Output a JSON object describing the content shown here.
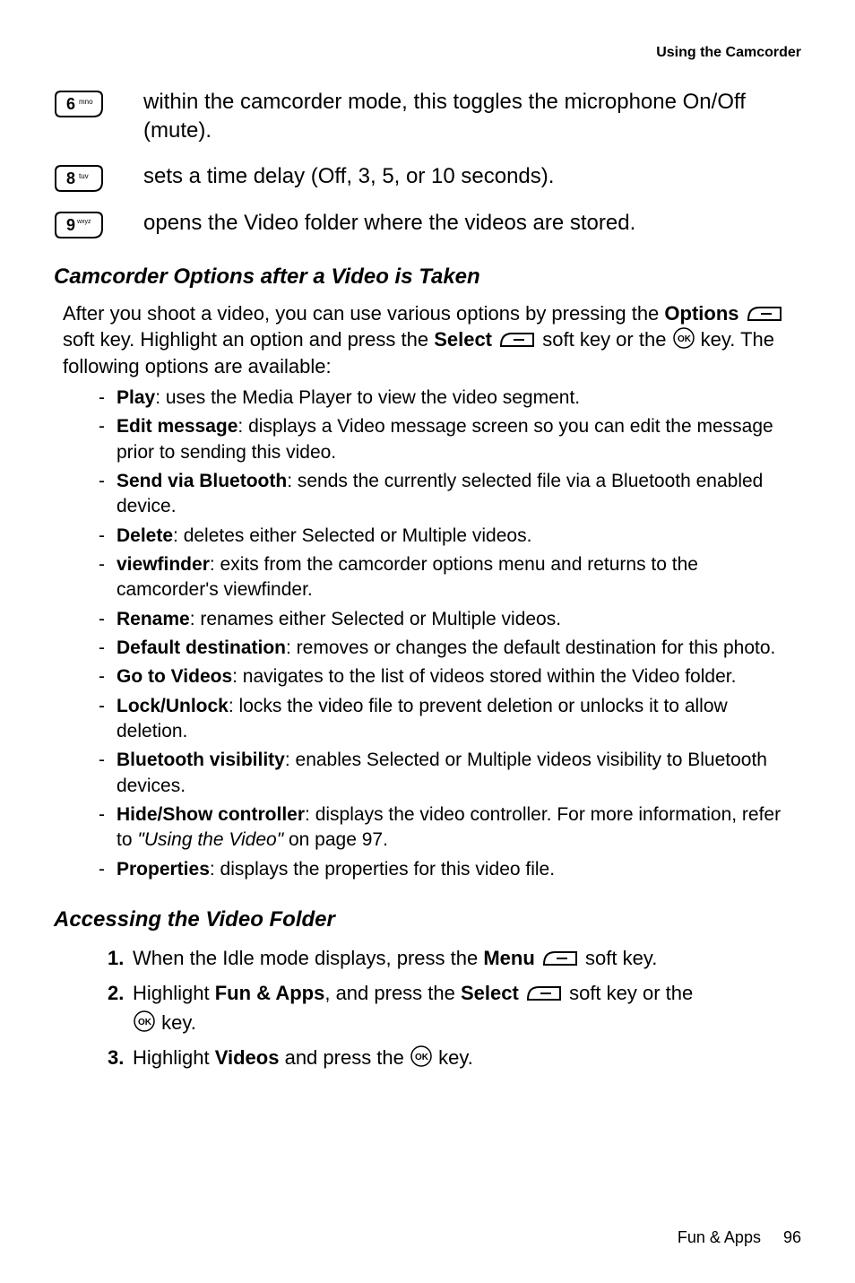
{
  "header": {
    "section": "Using the Camcorder"
  },
  "keys": [
    {
      "label": "6",
      "sub": "mno",
      "desc": "within the camcorder mode, this toggles the microphone On/Off (mute)."
    },
    {
      "label": "8",
      "sub": "tuv",
      "desc": "sets a time delay (Off, 3, 5, or 10 seconds)."
    },
    {
      "label": "9",
      "sub": "wxyz",
      "desc": "opens the Video folder where the videos are stored."
    }
  ],
  "section1": {
    "heading": "Camcorder Options after a Video is Taken",
    "intro_1": "After you shoot a video, you can use various options by pressing the ",
    "intro_options": "Options",
    "intro_2": " soft key. Highlight an option and press the ",
    "intro_select": "Select",
    "intro_3": " soft key or the ",
    "intro_4": " key. The following options are available:",
    "bullets": [
      {
        "term": "Play",
        "rest": ": uses the Media Player to view the video segment."
      },
      {
        "term": "Edit message",
        "rest": ": displays a Video message screen so you can edit the message prior to sending this video."
      },
      {
        "term": "Send via Bluetooth",
        "rest": ": sends the currently selected file via a Bluetooth enabled device."
      },
      {
        "term": "Delete",
        "rest": ": deletes either Selected or Multiple videos."
      },
      {
        "term": "viewfinder",
        "rest": ": exits from the camcorder options menu and returns to the camcorder's viewfinder."
      },
      {
        "term": "Rename",
        "rest": ": renames either Selected or Multiple videos."
      },
      {
        "term": "Default destination",
        "rest": ": removes or changes the default destination for this photo."
      },
      {
        "term": "Go to Videos",
        "rest": ": navigates to the list of videos stored within the Video folder."
      },
      {
        "term": "Lock/Unlock",
        "rest": ": locks the video file to prevent deletion or unlocks it to allow deletion."
      },
      {
        "term": "Bluetooth visibility",
        "rest": ": enables Selected or Multiple videos visibility to Bluetooth devices."
      },
      {
        "term": "Hide/Show controller",
        "rest_pre": ": displays the video controller. For more information, refer to ",
        "italic": "\"Using the Video\"",
        "rest_post": "  on page 97."
      },
      {
        "term": "Properties",
        "rest": ": displays the properties for this video file."
      }
    ]
  },
  "section2": {
    "heading": "Accessing the Video Folder",
    "steps": {
      "s1_a": "When the Idle mode displays, press the ",
      "s1_menu": "Menu",
      "s1_b": " soft key.",
      "s2_a": "Highlight ",
      "s2_fun": "Fun & Apps",
      "s2_b": ", and press the ",
      "s2_select": "Select",
      "s2_c": " soft key or the ",
      "s2_d": " key.",
      "s3_a": "Highlight ",
      "s3_videos": "Videos",
      "s3_b": " and press the ",
      "s3_c": " key."
    },
    "labels": {
      "n1": "1.",
      "n2": "2.",
      "n3": "3."
    }
  },
  "footer": {
    "label": "Fun & Apps",
    "page": "96"
  }
}
